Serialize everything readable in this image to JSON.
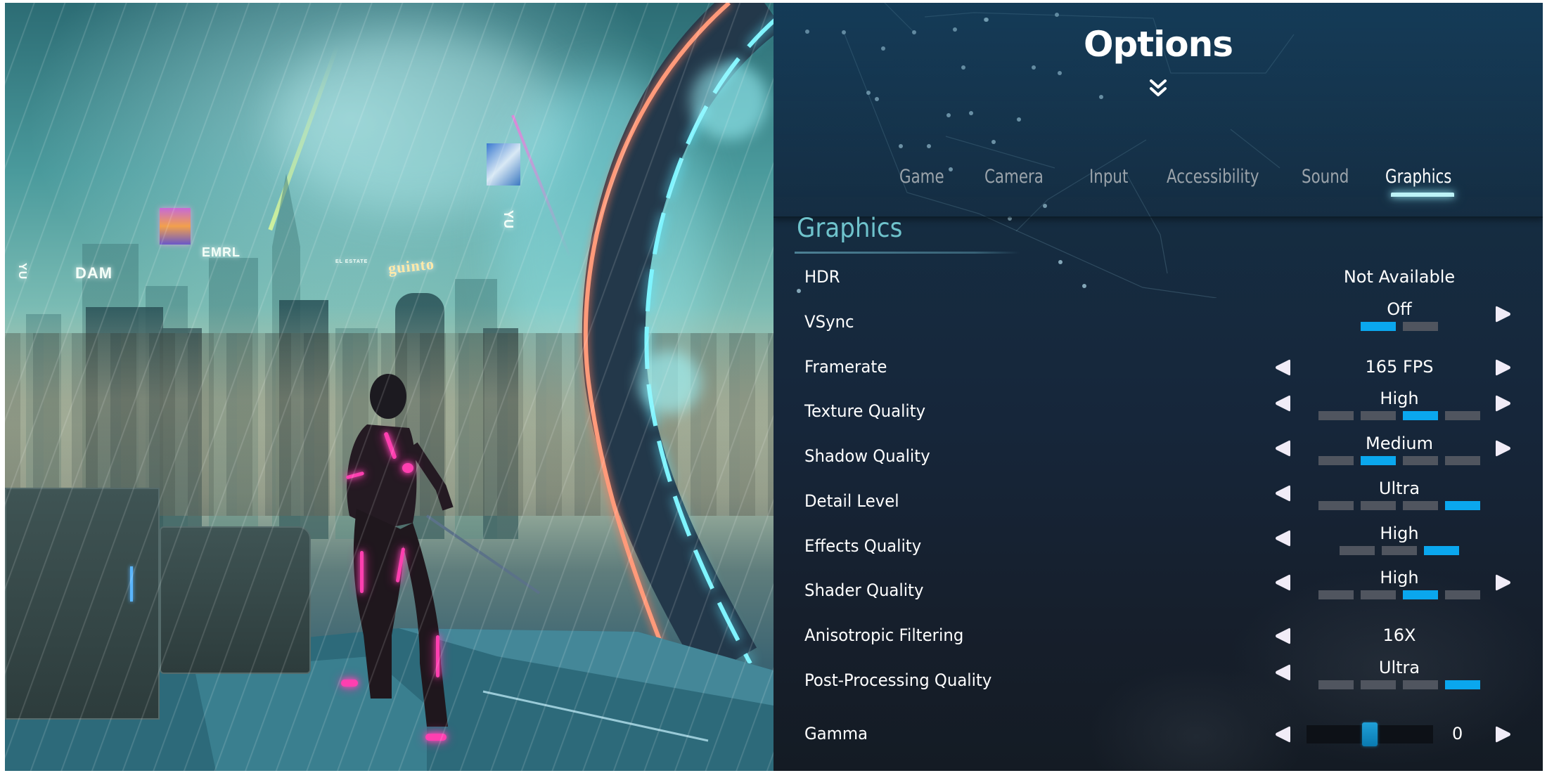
{
  "artwork": {
    "description": "Cyberpunk city rooftop in the rain with neon-suited character holding a katana facing a glowing portal ring",
    "signs": [
      "DAM",
      "EMRL",
      "guinto",
      "YU",
      "YU",
      "EL ESTATE"
    ],
    "colors": {
      "sky": "#4a9a9c",
      "neon_pink": "#ff3fb0",
      "portal_cyan": "#6ff0ff",
      "portal_orange": "#ff8a6a"
    }
  },
  "options": {
    "title": "Options",
    "expand_icon": "double-chevron-down-icon",
    "tabs": [
      {
        "label": "Game",
        "active": false
      },
      {
        "label": "Camera",
        "active": false
      },
      {
        "label": "Input",
        "active": false
      },
      {
        "label": "Accessibility",
        "active": false
      },
      {
        "label": "Sound",
        "active": false
      },
      {
        "label": "Graphics",
        "active": true
      }
    ],
    "section_title": "Graphics",
    "accent_color": "#0aa7ee",
    "section_color": "#6fc3cc",
    "settings": [
      {
        "label": "HDR",
        "value": "Not Available",
        "left_arrow": false,
        "right_arrow": false
      },
      {
        "label": "VSync",
        "value": "Off",
        "segments": 2,
        "selected": 0,
        "left_arrow": false,
        "right_arrow": true
      },
      {
        "label": "Framerate",
        "value": "165 FPS",
        "left_arrow": true,
        "right_arrow": true
      },
      {
        "label": "Texture Quality",
        "value": "High",
        "segments": 4,
        "selected": 2,
        "left_arrow": true,
        "right_arrow": true
      },
      {
        "label": "Shadow Quality",
        "value": "Medium",
        "segments": 4,
        "selected": 1,
        "left_arrow": true,
        "right_arrow": true
      },
      {
        "label": "Detail Level",
        "value": "Ultra",
        "segments": 4,
        "selected": 3,
        "left_arrow": true,
        "right_arrow": false
      },
      {
        "label": "Effects Quality",
        "value": "High",
        "segments": 3,
        "selected": 2,
        "left_arrow": true,
        "right_arrow": false
      },
      {
        "label": "Shader Quality",
        "value": "High",
        "segments": 4,
        "selected": 2,
        "left_arrow": true,
        "right_arrow": true
      },
      {
        "label": "Anisotropic Filtering",
        "value": "16X",
        "left_arrow": true,
        "right_arrow": false
      },
      {
        "label": "Post-Processing Quality",
        "value": "Ultra",
        "segments": 4,
        "selected": 3,
        "left_arrow": true,
        "right_arrow": false
      }
    ],
    "gamma": {
      "label": "Gamma",
      "value": "0",
      "slider_fraction": 0.5,
      "left_arrow": true,
      "right_arrow": true
    }
  }
}
